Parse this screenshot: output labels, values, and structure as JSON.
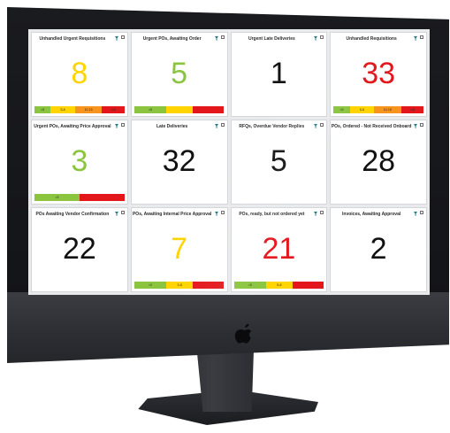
{
  "colors": {
    "yellow": "#ffd400",
    "green": "#8bc53f",
    "orange": "#f7941d",
    "red": "#e3171b",
    "black": "#111111"
  },
  "icons": {
    "filter": "funnel-icon",
    "settings": "settings-icon",
    "brand": "apple-logo"
  },
  "tiles": [
    {
      "title": "Unhandled Urgent Requisitions",
      "value": "8",
      "value_color": "#ffd400",
      "band": [
        "<5",
        "5-8",
        "10-15",
        ">15"
      ]
    },
    {
      "title": "Urgent POs, Awaiting Order",
      "value": "5",
      "value_color": "#8bc53f",
      "band": [
        "<5",
        "",
        ""
      ]
    },
    {
      "title": "Urgent Late Deliveries",
      "value": "1",
      "value_color": "#111111",
      "band": null
    },
    {
      "title": "Unhandled Requisitions",
      "value": "33",
      "value_color": "#e3171b",
      "band": [
        "<5",
        "5-8",
        "10-15",
        ">15"
      ]
    },
    {
      "title": "Urgent POs, Awaiting Price Approval",
      "value": "3",
      "value_color": "#8bc53f",
      "band": [
        "<5",
        ""
      ]
    },
    {
      "title": "Late Deliveries",
      "value": "32",
      "value_color": "#111111",
      "band": null
    },
    {
      "title": "RFQs, Overdue Vendor Replies",
      "value": "5",
      "value_color": "#111111",
      "band": null
    },
    {
      "title": "POs, Ordered - Not Received Onboard",
      "value": "28",
      "value_color": "#111111",
      "band": null
    },
    {
      "title": "POs Awaiting Vendor Confirmation",
      "value": "22",
      "value_color": "#111111",
      "band": null
    },
    {
      "title": "POs, Awaiting Internal Price Approval",
      "value": "7",
      "value_color": "#ffd400",
      "band": [
        "<2",
        "3-8",
        ""
      ]
    },
    {
      "title": "POs, ready, but not ordered yet",
      "value": "21",
      "value_color": "#e3171b",
      "band": [
        "<5",
        "5-8",
        ""
      ]
    },
    {
      "title": "Invoices, Awaiting Approval",
      "value": "2",
      "value_color": "#111111",
      "band": null
    }
  ]
}
